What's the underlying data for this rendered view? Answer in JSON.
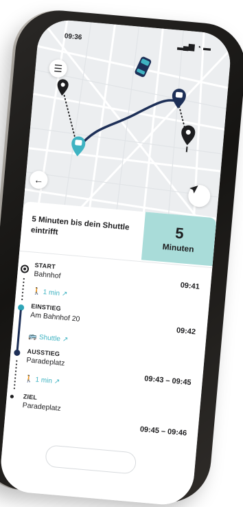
{
  "status": {
    "time": "09:36",
    "icons": "▂▄▆ ◔ ▬"
  },
  "map": {
    "menu_icon": "menu-icon",
    "back_icon": "arrow-left-icon",
    "locate_icon": "location-arrow-icon",
    "route_color": "#1d2f57",
    "pickup_color": "#2fa5b8"
  },
  "eta": {
    "message": "5 Minuten bis dein Shuttle eintrifft",
    "value": "5",
    "unit": "Minuten"
  },
  "itinerary": {
    "start": {
      "label": "START",
      "place": "Bahnhof",
      "time": "09:41"
    },
    "walk1": {
      "text": "1 min"
    },
    "boarding": {
      "label": "EINSTIEG",
      "place": "Am Bahnhof 20",
      "time": "09:42"
    },
    "ride": {
      "text": "Shuttle"
    },
    "alighting": {
      "label": "AUSSTIEG",
      "place": "Paradeplatz",
      "time": "09:43 – 09:45"
    },
    "walk2": {
      "text": "1 min"
    },
    "destination": {
      "label": "ZIEL",
      "place": "Paradeplatz",
      "time": "09:45 – 09:46"
    }
  },
  "colors": {
    "accent": "#a9dcd9",
    "teal": "#3fb3c2",
    "navy": "#1d2f57"
  }
}
